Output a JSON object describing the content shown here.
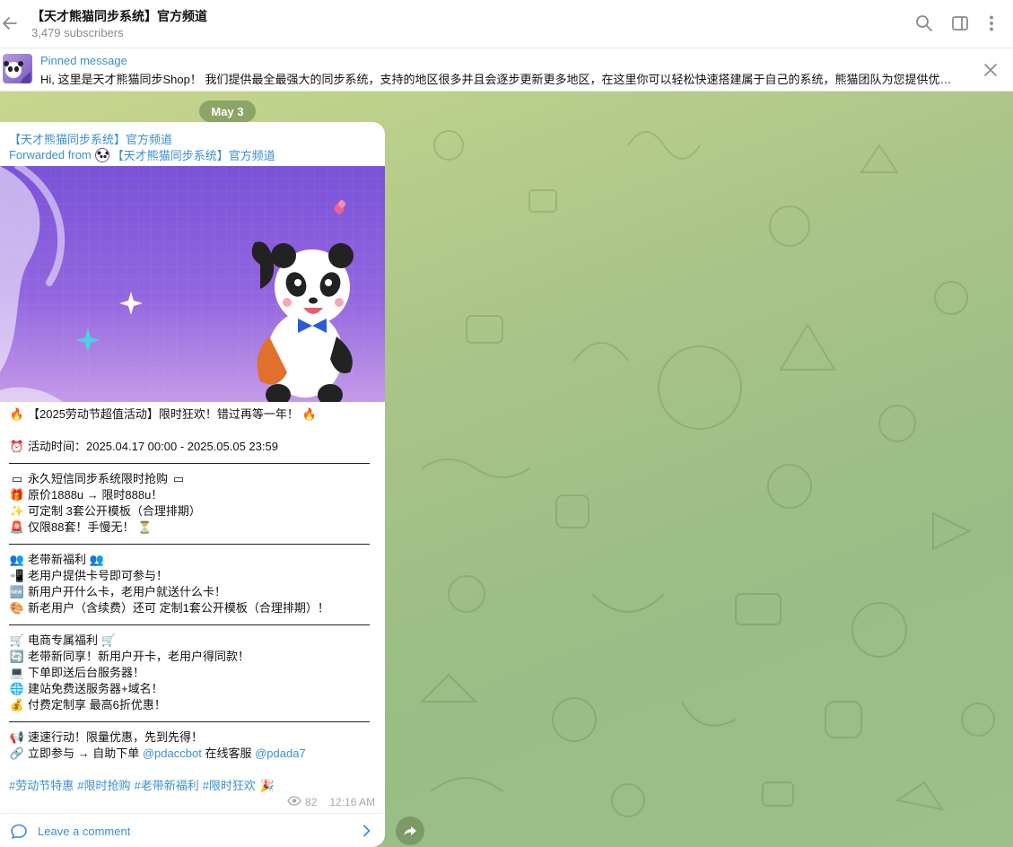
{
  "header": {
    "title": "【天才熊猫同步系统】官方频道",
    "subtitle": "3,479 subscribers"
  },
  "pinned": {
    "label": "Pinned message",
    "text": "Hi, 这里是天才熊猫同步Shop！ 我们提供最全最强大的同步系统，支持的地区很多并且会逐步更新更多地区，在这里你可以轻松快速搭建属于自己的系统，熊猫团队为您提供优…"
  },
  "chat": {
    "date": "May 3"
  },
  "message": {
    "channel": "【天才熊猫同步系统】官方频道",
    "forwarded_prefix": "Forwarded from",
    "forwarded_source": "【天才熊猫同步系统】官方频道",
    "lines": {
      "l1": "【2025劳动节超值活动】限时狂欢！错过再等一年！",
      "l2": "活动时间：2025.04.17 00:00 - 2025.05.05 23:59",
      "l3": "永久短信同步系统限时抢购",
      "l4": "原价1888u → 限时888u！",
      "l5": "可定制 3套公开模板（合理排期）",
      "l6": "仅限88套！手慢无！",
      "l7": "老带新福利",
      "l8": "老用户提供卡号即可参与！",
      "l9": "新用户开什么卡，老用户就送什么卡！",
      "l10": "新老用户（含续费）还可 定制1套公开模板（合理排期）！",
      "l11": "电商专属福利",
      "l12": "老带新同享！新用户开卡，老用户得同款！",
      "l13": "下单即送后台服务器！",
      "l14": "建站免费送服务器+域名！",
      "l15": "付费定制享 最高6折优惠！",
      "l16": "速速行动！限量优惠，先到先得！",
      "l17_pre": "立即参与 → 自助下单",
      "l17_bot": "@pdaccbot",
      "l17_mid": "在线客服",
      "l17_support": "@pdada7"
    },
    "hashtags": [
      "#劳动节特惠",
      "#限时抢购",
      "#老带新福利",
      "#限时狂欢"
    ],
    "views": "82",
    "time": "12:16 AM",
    "comment_label": "Leave a comment"
  },
  "icons": {
    "back": "back-arrow-icon",
    "search": "search-icon",
    "sidebar": "sidebar-toggle-icon",
    "more": "more-vertical-icon",
    "close": "close-icon",
    "eye": "eye-icon",
    "comment": "comment-bubble-icon",
    "chevron": "chevron-right-icon",
    "share": "share-arrow-icon"
  },
  "colors": {
    "accent": "#3a8fd1",
    "chat_bg": "#a8c488",
    "banner": "#8a5ee0"
  }
}
